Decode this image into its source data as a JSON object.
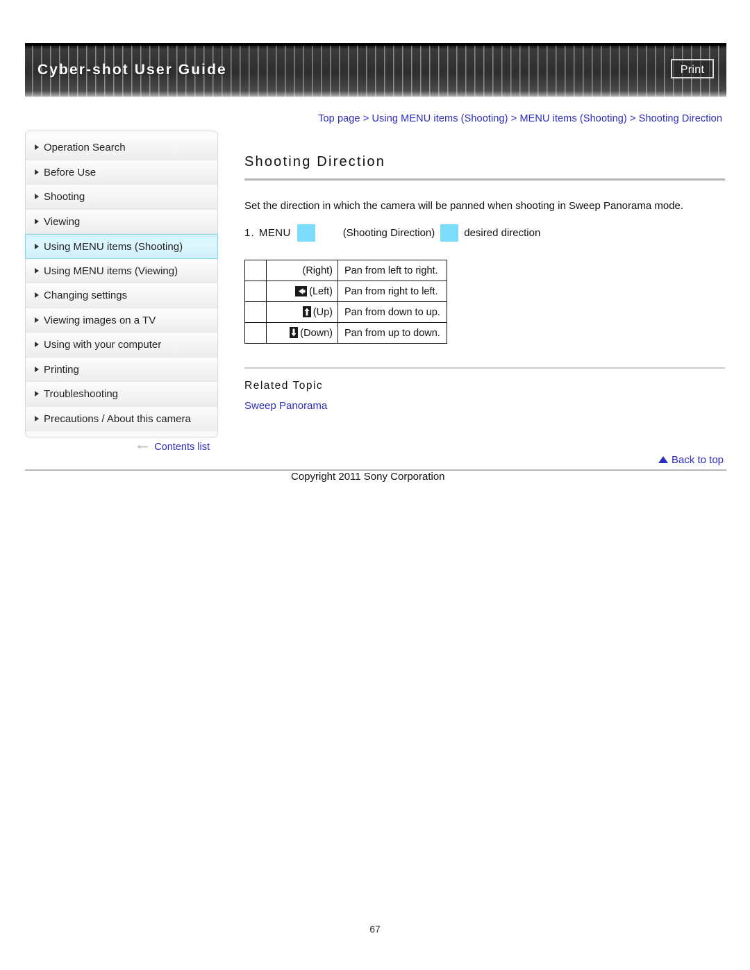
{
  "header": {
    "title": "Cyber-shot User Guide",
    "print_label": "Print"
  },
  "breadcrumb": {
    "full_text": "Top page > Using MENU items (Shooting) > MENU items (Shooting) > Shooting Direction",
    "items": [
      "Top page",
      "Using MENU items (Shooting)",
      "MENU items (Shooting)",
      "Shooting Direction"
    ],
    "separator": ">"
  },
  "sidebar": {
    "items": [
      {
        "label": "Operation Search",
        "active": false
      },
      {
        "label": "Before Use",
        "active": false
      },
      {
        "label": "Shooting",
        "active": false
      },
      {
        "label": "Viewing",
        "active": false
      },
      {
        "label": "Using MENU items (Shooting)",
        "active": true
      },
      {
        "label": "Using MENU items (Viewing)",
        "active": false
      },
      {
        "label": "Changing settings",
        "active": false
      },
      {
        "label": "Viewing images on a TV",
        "active": false
      },
      {
        "label": "Using with your computer",
        "active": false
      },
      {
        "label": "Printing",
        "active": false
      },
      {
        "label": "Troubleshooting",
        "active": false
      },
      {
        "label": "Precautions / About this camera",
        "active": false
      }
    ],
    "contents_list_label": "Contents list",
    "active_highlight_color": "#d6f4fd",
    "link_color": "#2b2bbd"
  },
  "main": {
    "heading": "Shooting Direction",
    "description": "Set the direction in which the camera will be panned when shooting in Sweep Panorama mode.",
    "step": {
      "number": "1.",
      "menu_label": "MENU",
      "middle_label": "(Shooting Direction)",
      "end_label": "desired direction",
      "placeholder_color": "#7ddcfb"
    },
    "table": {
      "rows": [
        {
          "icon": "arrow-right-icon",
          "has_icon": false,
          "label": "(Right)",
          "description": "Pan from left to right."
        },
        {
          "icon": "arrow-left-icon",
          "has_icon": true,
          "label": "(Left)",
          "description": "Pan from right to left."
        },
        {
          "icon": "arrow-up-icon",
          "has_icon": true,
          "label": "(Up)",
          "description": "Pan from down to up."
        },
        {
          "icon": "arrow-down-icon",
          "has_icon": true,
          "label": "(Down)",
          "description": "Pan from up to down."
        }
      ]
    },
    "related": {
      "title": "Related Topic",
      "links": [
        "Sweep Panorama"
      ]
    }
  },
  "footer": {
    "back_to_top": "Back to top",
    "copyright": "Copyright 2011 Sony Corporation",
    "page_number": "67"
  }
}
